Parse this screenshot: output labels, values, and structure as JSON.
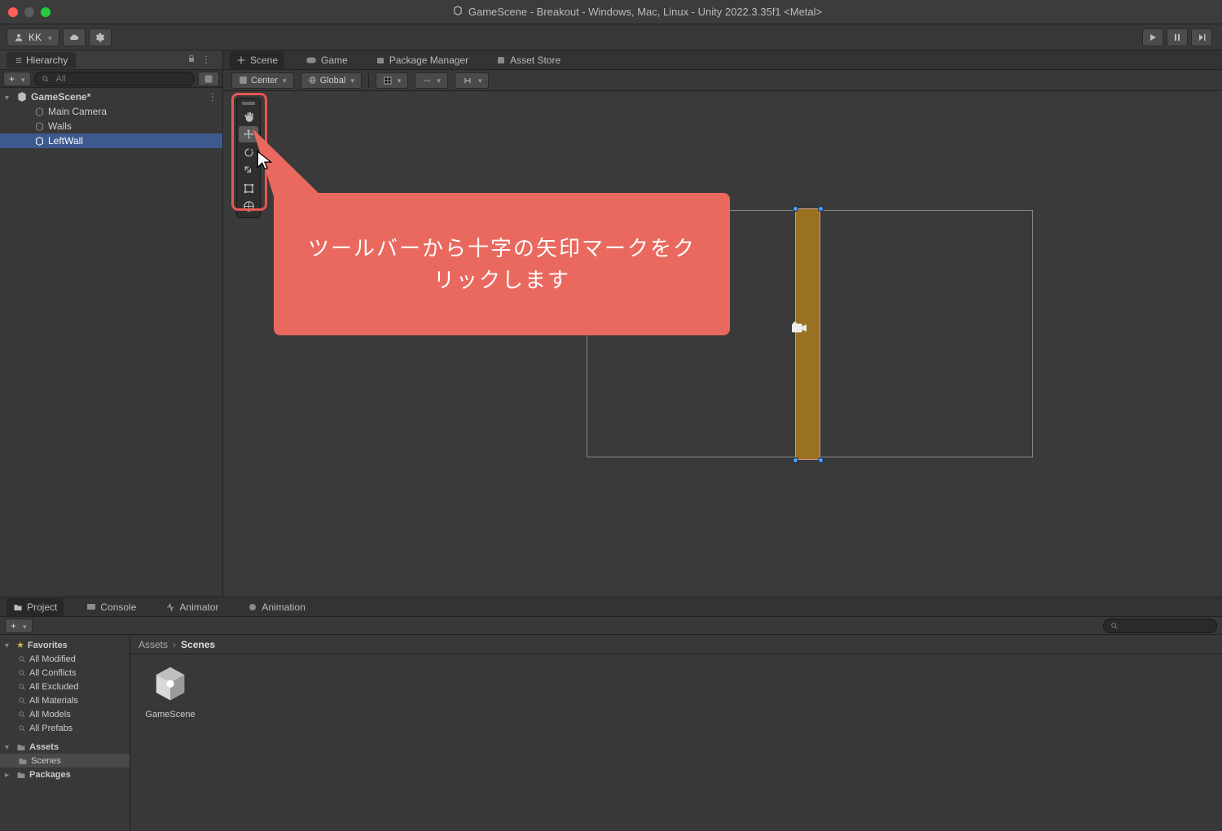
{
  "titlebar": {
    "title": "GameScene - Breakout - Windows, Mac, Linux - Unity 2022.3.35f1 <Metal>"
  },
  "toolbar": {
    "account_label": "KK"
  },
  "hierarchy": {
    "tab_label": "Hierarchy",
    "search_placeholder": "All",
    "scene_name": "GameScene*",
    "items": [
      {
        "label": "Main Camera"
      },
      {
        "label": "Walls"
      },
      {
        "label": "LeftWall",
        "selected": true
      }
    ]
  },
  "scene_tabs": {
    "scene": "Scene",
    "game": "Game",
    "package_manager": "Package Manager",
    "asset_store": "Asset Store"
  },
  "scene_toolbar": {
    "pivot": "Center",
    "space": "Global"
  },
  "callout": {
    "text": "ツールバーから十字の矢印マークをクリックします"
  },
  "bottom_tabs": {
    "project": "Project",
    "console": "Console",
    "animator": "Animator",
    "animation": "Animation"
  },
  "project_tree": {
    "favorites": "Favorites",
    "fav_items": [
      "All Modified",
      "All Conflicts",
      "All Excluded",
      "All Materials",
      "All Models",
      "All Prefabs"
    ],
    "assets": "Assets",
    "scenes": "Scenes",
    "packages": "Packages"
  },
  "breadcrumb": {
    "root": "Assets",
    "current": "Scenes"
  },
  "asset": {
    "name": "GameScene"
  }
}
